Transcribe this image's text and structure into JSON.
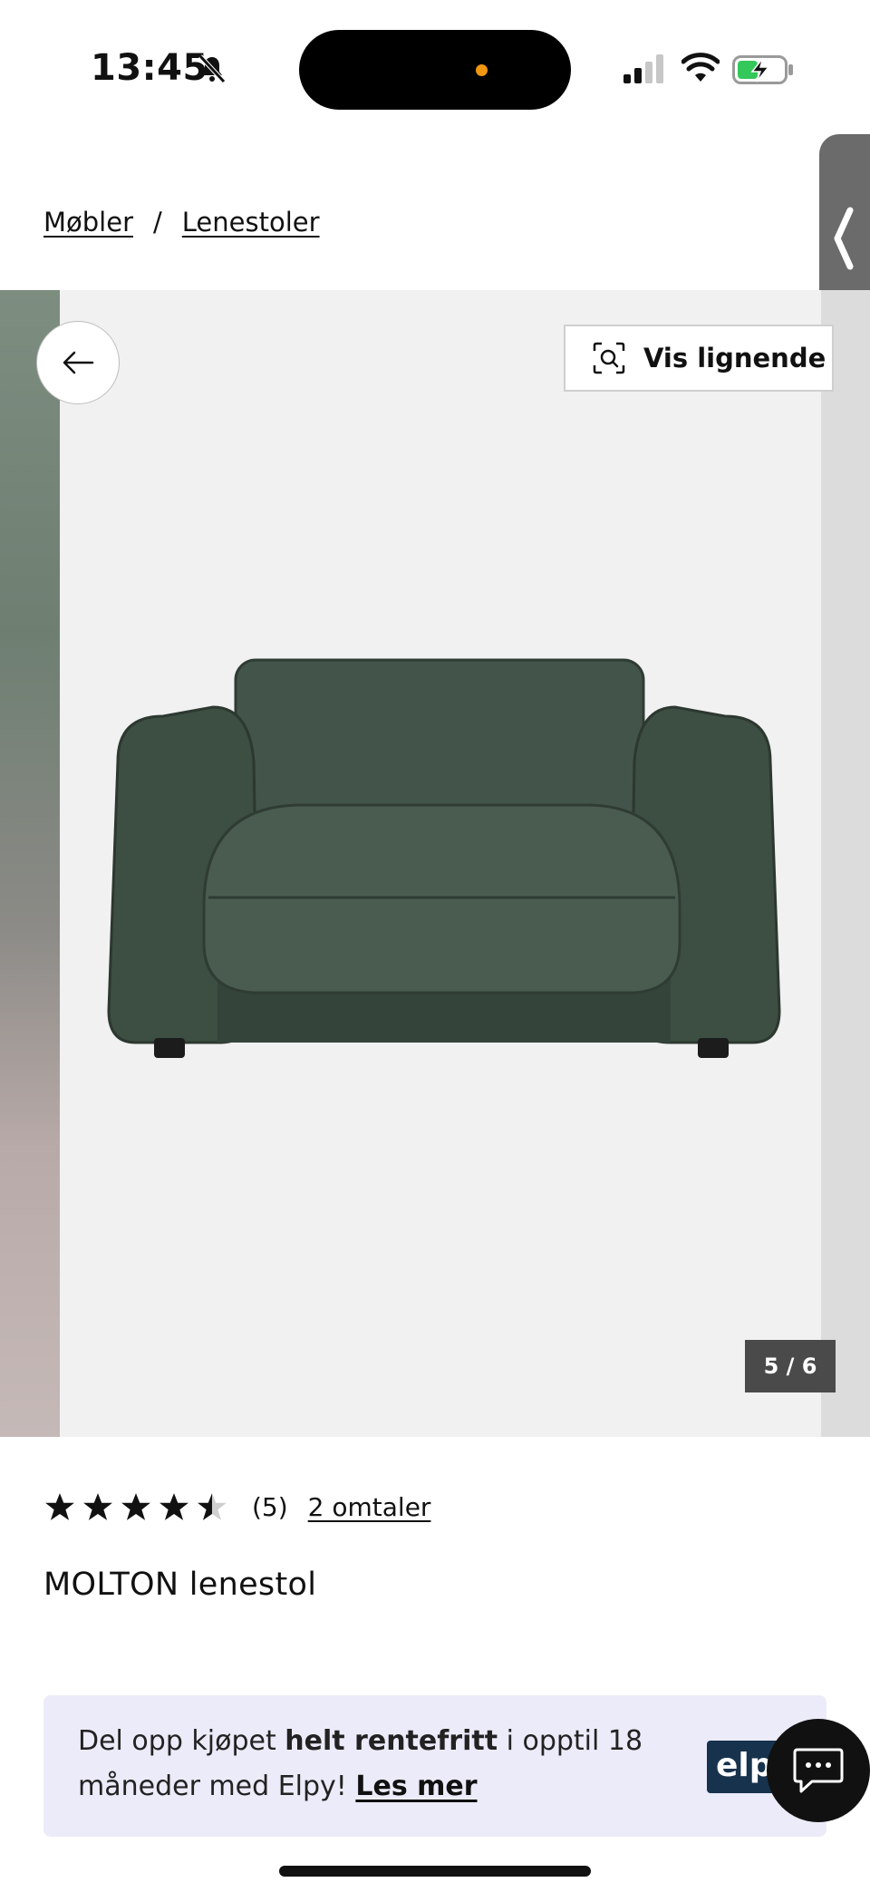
{
  "status_bar": {
    "time": "13:45"
  },
  "breadcrumb": {
    "items": [
      "Møbler",
      "Lenestoler"
    ],
    "separator": "/"
  },
  "gallery": {
    "similar_button": "Vis lignende",
    "counter": "5 / 6"
  },
  "product": {
    "rating_value": 4.5,
    "rating_count": "(5)",
    "reviews_link": "2 omtaler",
    "title": "MOLTON lenestol"
  },
  "promo": {
    "text_1": "Del opp kjøpet ",
    "text_bold": "helt rentefritt",
    "text_2": " i opptil 18 måneder med Elpy! ",
    "link": "Les mer",
    "logo": "elpy"
  },
  "icons": {
    "status": [
      "bell-slash-icon",
      "signal-icon",
      "wifi-icon",
      "battery-charging-icon"
    ],
    "back": "arrow-left-icon",
    "similar": "visual-search-icon",
    "chat": "chat-icon",
    "side_tab": "chevron-left-icon"
  },
  "colors": {
    "promo_bg": "#ebebf9",
    "counter_bg": "#4a4a4a",
    "elpy_logo_bg": "#17324d",
    "battery_green": "#34c759",
    "sofa_green": "#3f4f42"
  }
}
